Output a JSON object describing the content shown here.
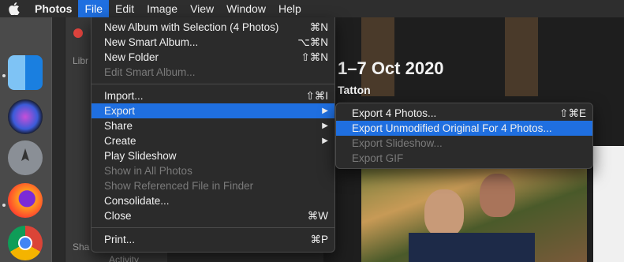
{
  "menubar": {
    "app": "Photos",
    "items": [
      "File",
      "Edit",
      "Image",
      "View",
      "Window",
      "Help"
    ]
  },
  "window": {
    "sidebar_labels": [
      "Libr",
      "Sha",
      "Activity"
    ],
    "headline": "1–7 Oct 2020",
    "place": "Tatton"
  },
  "file_menu": {
    "items": [
      {
        "label": "New Album with Selection (4 Photos)",
        "shortcut": "⌘N"
      },
      {
        "label": "New Smart Album...",
        "shortcut": "⌥⌘N"
      },
      {
        "label": "New Folder",
        "shortcut": "⇧⌘N"
      },
      {
        "label": "Edit Smart Album...",
        "shortcut": ""
      },
      {
        "label": "Import...",
        "shortcut": "⇧⌘I"
      },
      {
        "label": "Export",
        "shortcut": ""
      },
      {
        "label": "Share",
        "shortcut": ""
      },
      {
        "label": "Create",
        "shortcut": ""
      },
      {
        "label": "Play Slideshow",
        "shortcut": ""
      },
      {
        "label": "Show in All Photos",
        "shortcut": ""
      },
      {
        "label": "Show Referenced File in Finder",
        "shortcut": ""
      },
      {
        "label": "Consolidate...",
        "shortcut": ""
      },
      {
        "label": "Close",
        "shortcut": "⌘W"
      },
      {
        "label": "Print...",
        "shortcut": "⌘P"
      }
    ]
  },
  "export_submenu": {
    "items": [
      {
        "label": "Export 4 Photos...",
        "shortcut": "⇧⌘E"
      },
      {
        "label": "Export Unmodified Original For 4 Photos...",
        "shortcut": ""
      },
      {
        "label": "Export Slideshow...",
        "shortcut": ""
      },
      {
        "label": "Export GIF",
        "shortcut": ""
      }
    ]
  },
  "colors": {
    "highlight": "#1f6fe0",
    "menu_bg": "#2b2b2b",
    "disabled_text": "#7a7a7a"
  }
}
